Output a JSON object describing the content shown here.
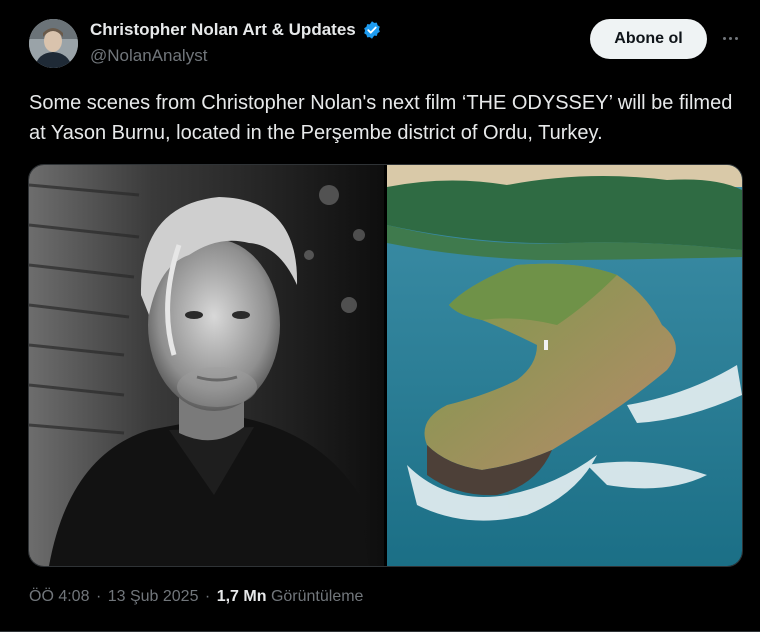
{
  "author": {
    "display_name": "Christopher Nolan Art & Updates",
    "handle": "@NolanAnalyst",
    "verified": true,
    "avatar_icon": "profile-avatar"
  },
  "actions": {
    "follow_label": "Abone ol",
    "more_icon": "more-horizontal-icon"
  },
  "tweet": {
    "text": "Some scenes from Christopher Nolan's next film ‘THE ODYSSEY’ will be filmed at Yason Burnu, located in the Perşembe district of Ordu, Turkey."
  },
  "media": {
    "images": [
      {
        "name": "portrait-photo",
        "kind": "black-and-white portrait"
      },
      {
        "name": "aerial-coast-photo",
        "kind": "aerial coastline"
      }
    ]
  },
  "meta": {
    "time": "ÖÖ 4:08",
    "date": "13 Şub 2025",
    "views_count": "1,7 Mn",
    "views_label": "Görüntüleme"
  },
  "colors": {
    "background": "#000000",
    "text_primary": "#e7e9ea",
    "text_secondary": "#71767b",
    "verified_blue": "#1d9bf0",
    "follow_bg": "#eff3f4"
  }
}
